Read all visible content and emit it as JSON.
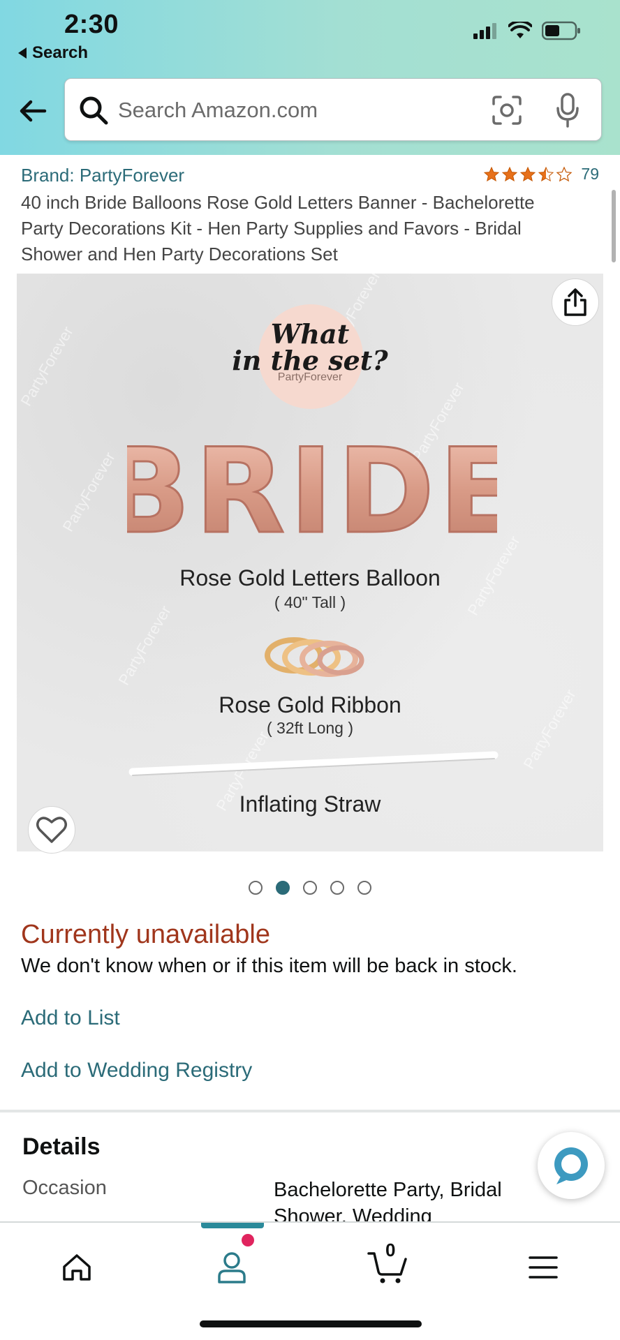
{
  "status_bar": {
    "time": "2:30",
    "back_label": "Search"
  },
  "search": {
    "placeholder": "Search Amazon.com"
  },
  "product": {
    "brand": "Brand: PartyForever",
    "rating": 3.5,
    "rating_count": "79",
    "title": "40 inch Bride Balloons Rose Gold Letters Banner - Bachelorette Party Decorations Kit - Hen Party Supplies and Favors - Bridal Shower and Hen Party Decorations Set"
  },
  "image": {
    "heading_line1": "What",
    "heading_line2": "in the set?",
    "logo_text": "PartyForever",
    "balloon_word": "BRIDE",
    "item1_name": "Rose Gold Letters Balloon",
    "item1_size": "( 40\" Tall )",
    "item2_name": "Rose Gold Ribbon",
    "item2_size": "( 32ft Long )",
    "item3_name": "Inflating Straw",
    "watermark": "PartyForever",
    "total_slides": 5,
    "active_slide": 2
  },
  "availability": {
    "status": "Currently unavailable",
    "message": "We don't know when or if this item will be back in stock.",
    "add_to_list": "Add to List",
    "add_to_registry": "Add to Wedding Registry"
  },
  "details": {
    "title": "Details",
    "rows": [
      {
        "key": "Occasion",
        "value": "Bachelorette Party, Bridal Shower, Wedding"
      }
    ]
  },
  "bottom_nav": {
    "items": [
      "home-icon",
      "account-icon",
      "cart-icon",
      "menu-icon"
    ],
    "cart_count": "0",
    "active": "account"
  },
  "colors": {
    "link": "#2b6b78",
    "unavailable": "#a0361c",
    "star": "#e7711b",
    "rose_gold": "#d9a08f"
  }
}
